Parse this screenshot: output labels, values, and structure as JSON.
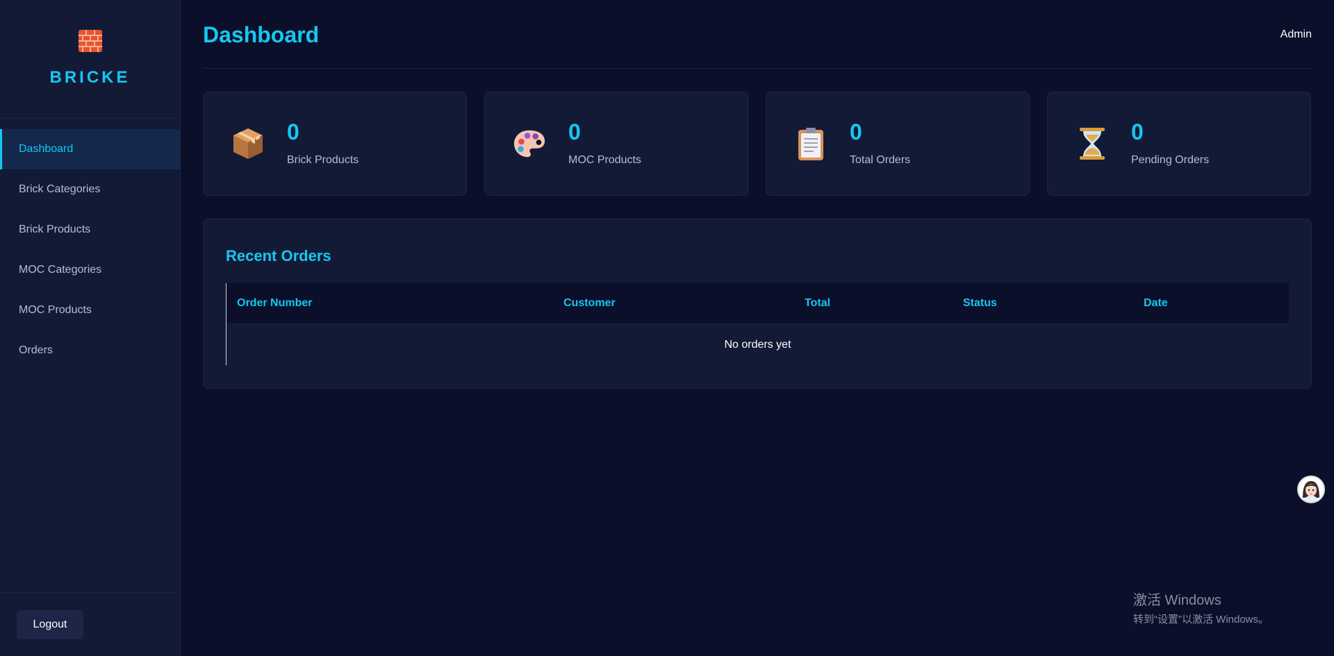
{
  "sidebar": {
    "brand": {
      "name": "BRICKE",
      "icon": "brick-icon"
    },
    "nav": [
      {
        "label": "Dashboard",
        "active": true
      },
      {
        "label": "Brick Categories",
        "active": false
      },
      {
        "label": "Brick Products",
        "active": false
      },
      {
        "label": "MOC Categories",
        "active": false
      },
      {
        "label": "MOC Products",
        "active": false
      },
      {
        "label": "Orders",
        "active": false
      }
    ],
    "logout_label": "Logout"
  },
  "header": {
    "title": "Dashboard",
    "user": "Admin"
  },
  "stats": [
    {
      "value": "0",
      "label": "Brick Products",
      "icon": "package-icon"
    },
    {
      "value": "0",
      "label": "MOC Products",
      "icon": "palette-icon"
    },
    {
      "value": "0",
      "label": "Total Orders",
      "icon": "clipboard-icon"
    },
    {
      "value": "0",
      "label": "Pending Orders",
      "icon": "hourglass-icon"
    }
  ],
  "recent_orders": {
    "title": "Recent Orders",
    "columns": [
      "Order Number",
      "Customer",
      "Total",
      "Status",
      "Date"
    ],
    "empty_text": "No orders yet"
  },
  "watermark": {
    "line1": "激活 Windows",
    "line2": "转到“设置”以激活 Windows。"
  },
  "colors": {
    "accent": "#14c8f0",
    "background": "#0b0f2a",
    "surface": "#131a36"
  }
}
